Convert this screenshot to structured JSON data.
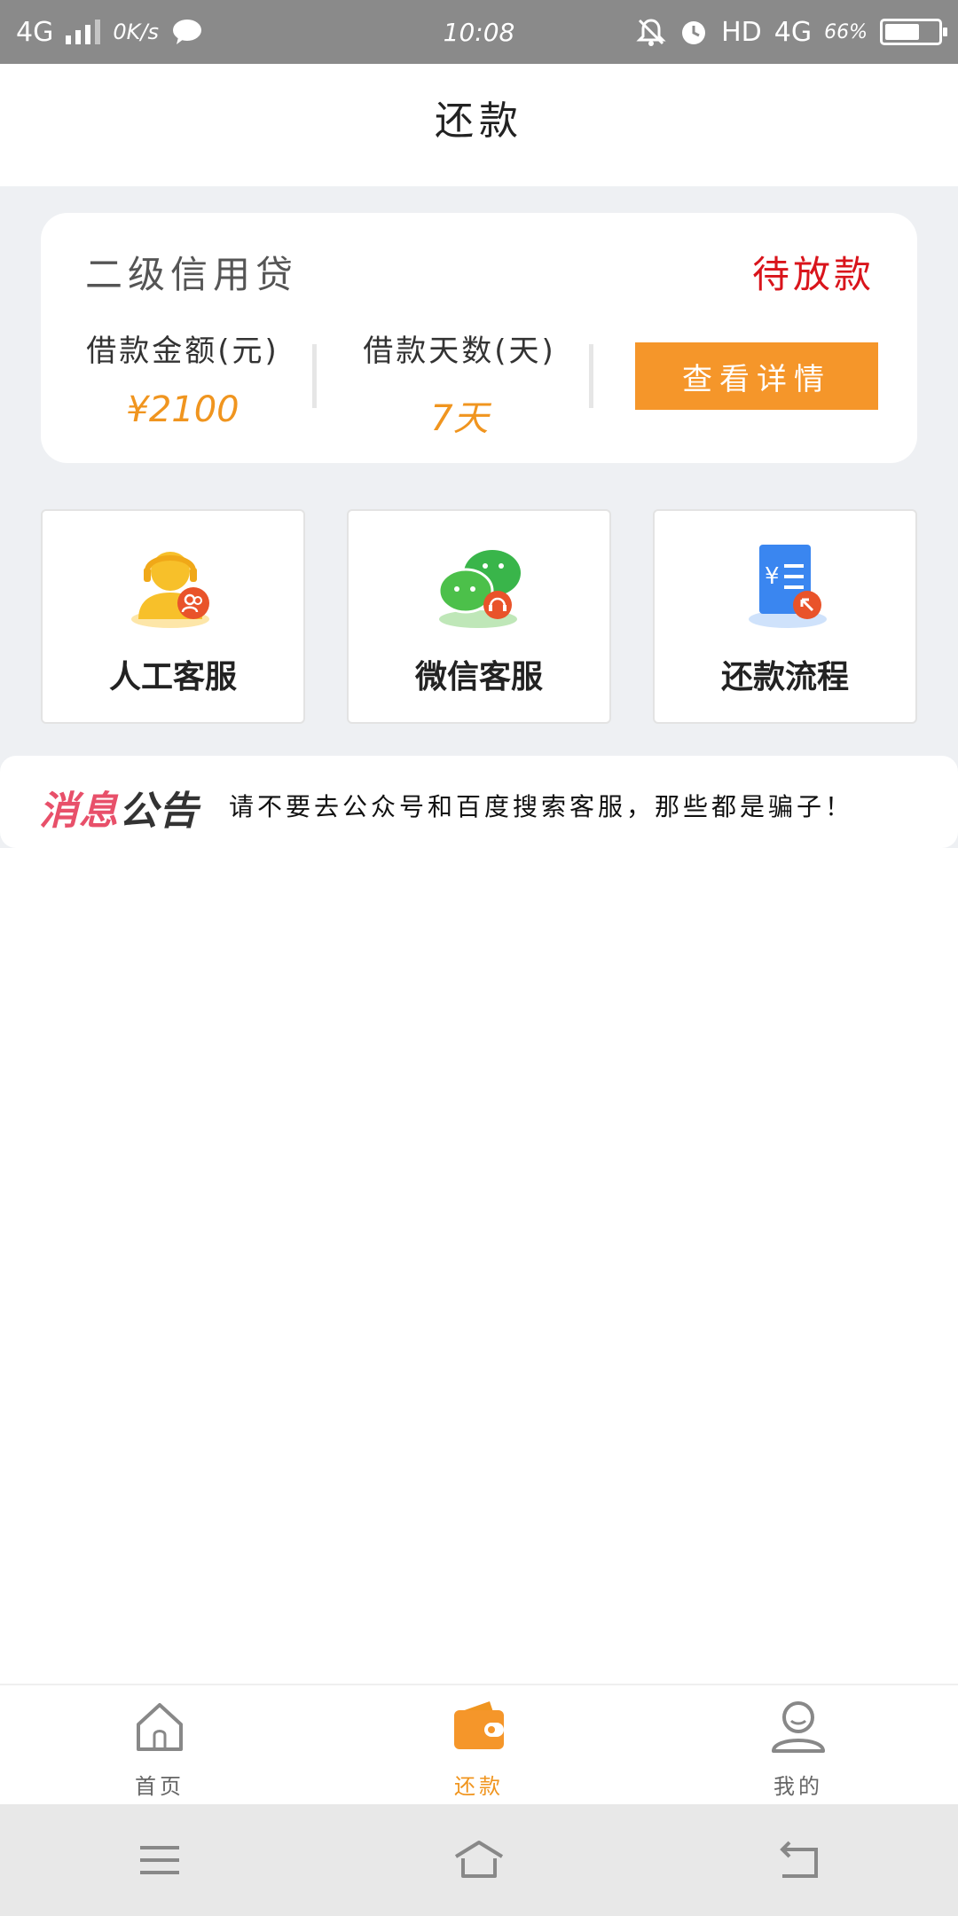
{
  "status_bar": {
    "network_left": "4G",
    "speed": "0K/s",
    "time": "10:08",
    "hd": "HD",
    "network_right": "4G",
    "battery_pct": "66%",
    "battery_level": 0.66
  },
  "header": {
    "title": "还款"
  },
  "loan_card": {
    "product_name": "二级信用贷",
    "status": "待放款",
    "amount_label": "借款金额(元)",
    "amount_value": "¥2100",
    "days_label": "借款天数(天)",
    "days_value": "7天",
    "detail_button": "查看详情"
  },
  "services": [
    {
      "label": "人工客服",
      "icon": "agent-headset-icon"
    },
    {
      "label": "微信客服",
      "icon": "wechat-chat-icon"
    },
    {
      "label": "还款流程",
      "icon": "repayment-document-icon"
    }
  ],
  "notice": {
    "tag_part1": "消息",
    "tag_part2": "公告",
    "text": "请不要去公众号和百度搜索客服，那些都是骗子！"
  },
  "tab_bar": {
    "items": [
      {
        "label": "首页",
        "icon": "home-icon",
        "active": false
      },
      {
        "label": "还款",
        "icon": "wallet-icon",
        "active": true
      },
      {
        "label": "我的",
        "icon": "user-icon",
        "active": false
      }
    ]
  },
  "colors": {
    "accent_orange": "#f5962a",
    "status_red": "#d9141b",
    "background_gray": "#eef0f3",
    "notice_pink": "#e8506a"
  }
}
